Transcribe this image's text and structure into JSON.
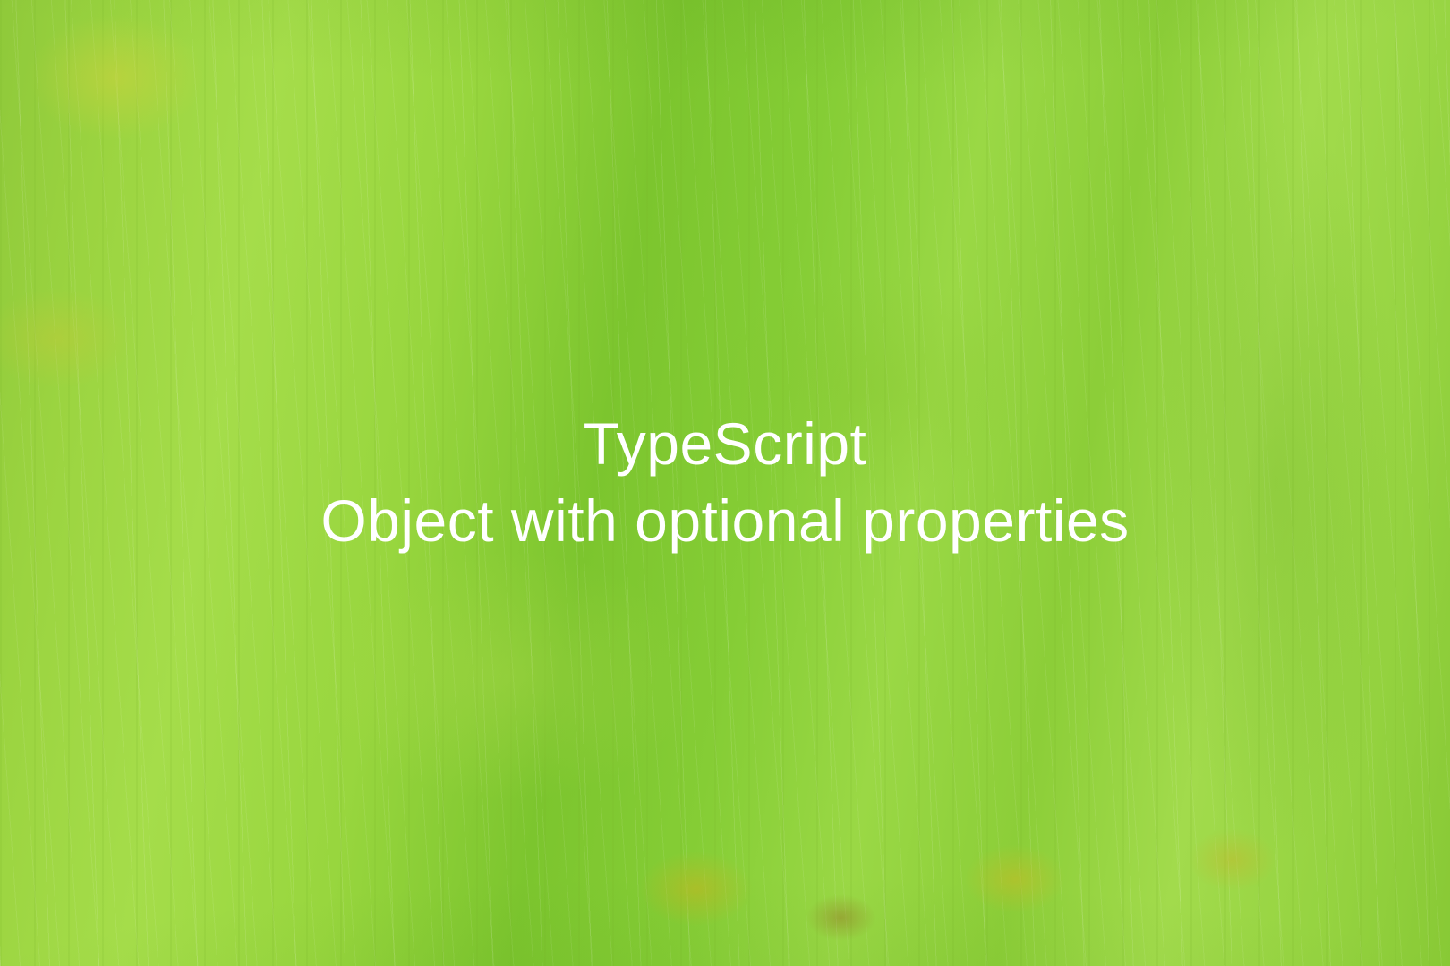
{
  "title": {
    "line1": "TypeScript",
    "line2": "Object with optional properties"
  },
  "colors": {
    "text": "#ffffff",
    "leaf_primary": "#8fc93a",
    "leaf_light": "#a5dd4a",
    "leaf_dark": "#7cc52e"
  }
}
